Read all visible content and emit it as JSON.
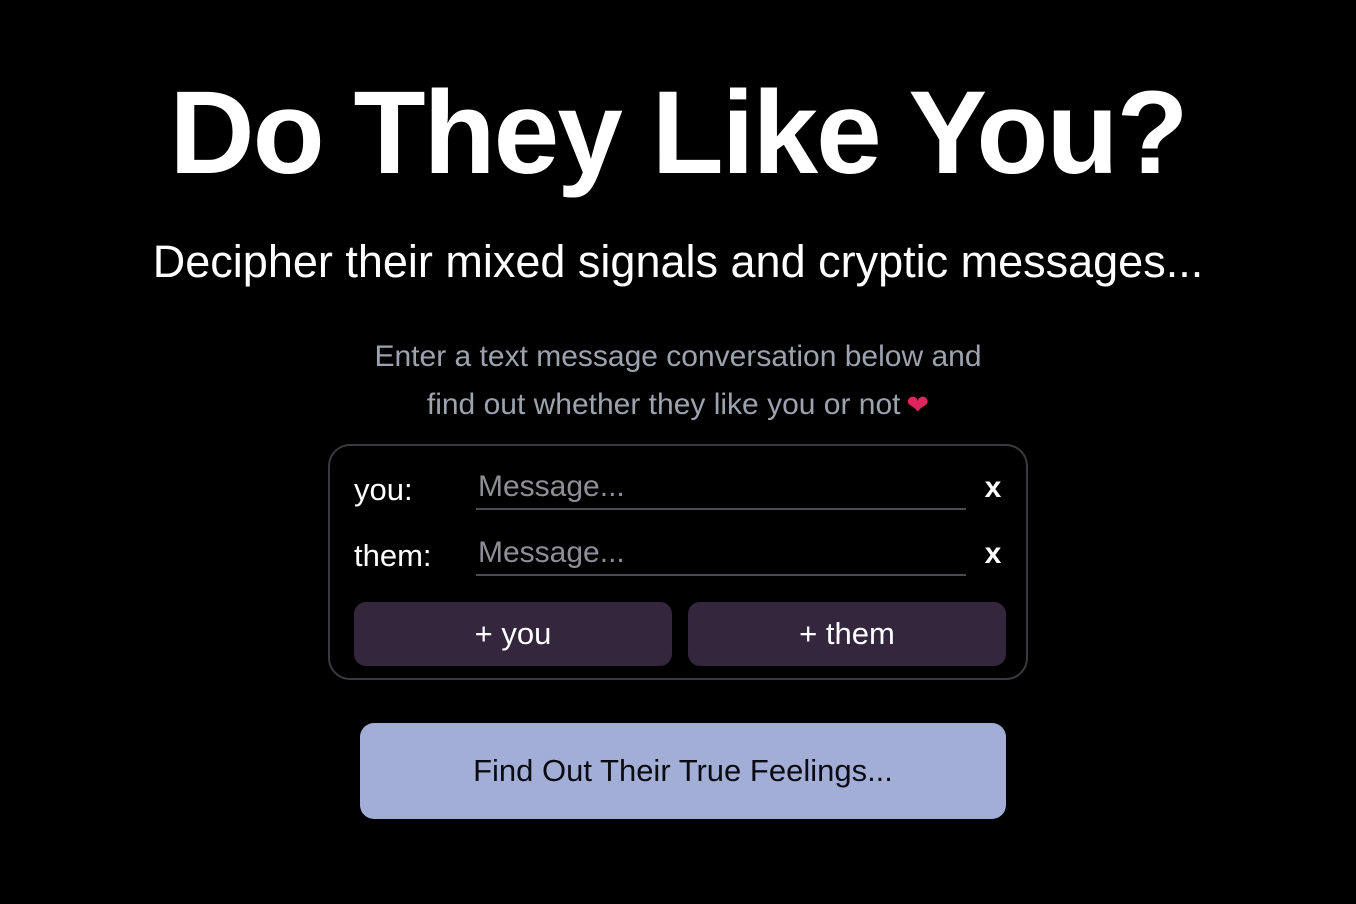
{
  "header": {
    "title": "Do They Like You?",
    "subtitle": "Decipher their mixed signals and cryptic messages..."
  },
  "intro": {
    "line1": "Enter a text message conversation below and",
    "line2": "find out whether they like you or not",
    "heart_icon": "❤"
  },
  "conversation": {
    "rows": [
      {
        "label": "you:",
        "value": "",
        "placeholder": "Message...",
        "remove_label": "x"
      },
      {
        "label": "them:",
        "value": "",
        "placeholder": "Message...",
        "remove_label": "x"
      }
    ],
    "add_you_label": "+ you",
    "add_them_label": "+ them"
  },
  "cta": {
    "label": "Find Out Their True Feelings..."
  },
  "colors": {
    "background": "#000000",
    "add_button_bg": "#33263d",
    "cta_bg": "#a3aed6",
    "heart": "#e0245e"
  }
}
